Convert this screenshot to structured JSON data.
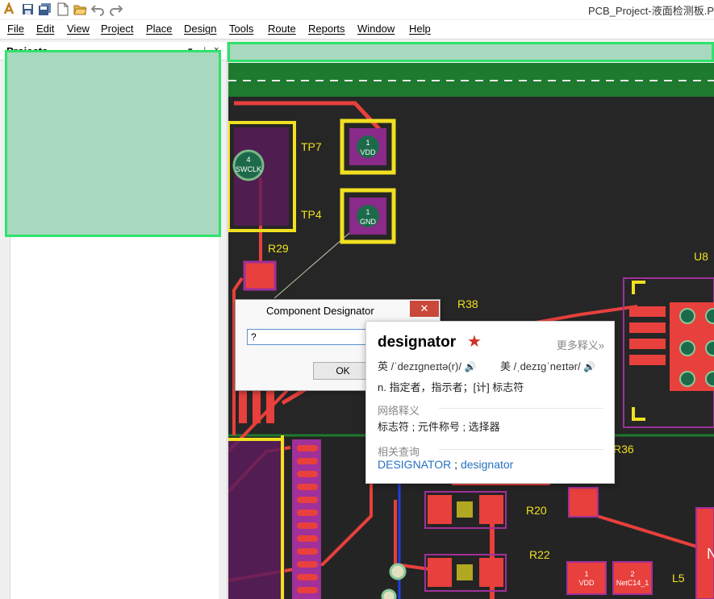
{
  "window": {
    "title": "PCB_Project-液面检测板.P"
  },
  "menu": [
    "File",
    "Edit",
    "View",
    "Project",
    "Place",
    "Design",
    "Tools",
    "Route",
    "Reports",
    "Window",
    "Help"
  ],
  "projects_panel": {
    "title": "Projects",
    "controls": [
      "▾",
      "⊥",
      "×"
    ]
  },
  "pcb": {
    "labels": {
      "tp7": "TP7",
      "tp4": "TP4",
      "r29": "R29",
      "r38": "R38",
      "u8": "U8",
      "r36": "R36",
      "r20": "R20",
      "r22": "R22",
      "l5": "L5"
    },
    "pads": {
      "vdd_num": "1",
      "vdd_net": "VDD",
      "gnd_num": "1",
      "gnd_net": "GND",
      "swclk_num": "4",
      "swclk_net": "SWCLK",
      "vdd2_num": "1",
      "vdd2_net": "VDD",
      "netc_num": "2",
      "netc_net": "NetC14_1",
      "edge_text": "N"
    }
  },
  "dialog": {
    "title": "Component Designator",
    "close": "✕",
    "input_value": "?",
    "ok": "OK"
  },
  "dict": {
    "word": "designator",
    "star": "★",
    "more": "更多释义»",
    "uk_label": "英",
    "uk_ipa": "/ˈdezɪgneɪtə(r)/",
    "us_label": "美",
    "us_ipa": "/ˌdezɪɡˈneɪtər/",
    "speaker": "🔊",
    "definition": "n. 指定者，指示者；[计] 标志符",
    "web_title": "网络释义",
    "web_def": "标志符 ; 元件称号 ; 选择器",
    "related_title": "相关查询",
    "related_1": "DESIGNATOR",
    "related_sep": " ; ",
    "related_2": "designator"
  },
  "colors": {
    "accent_green": "#2ee36a",
    "panel_fill": "#a9d8c0",
    "pcb_bg": "#1c1c1c",
    "copper_red": "#e8403c",
    "silk_yellow": "#f0e020",
    "pad_purple": "#a0309a"
  }
}
